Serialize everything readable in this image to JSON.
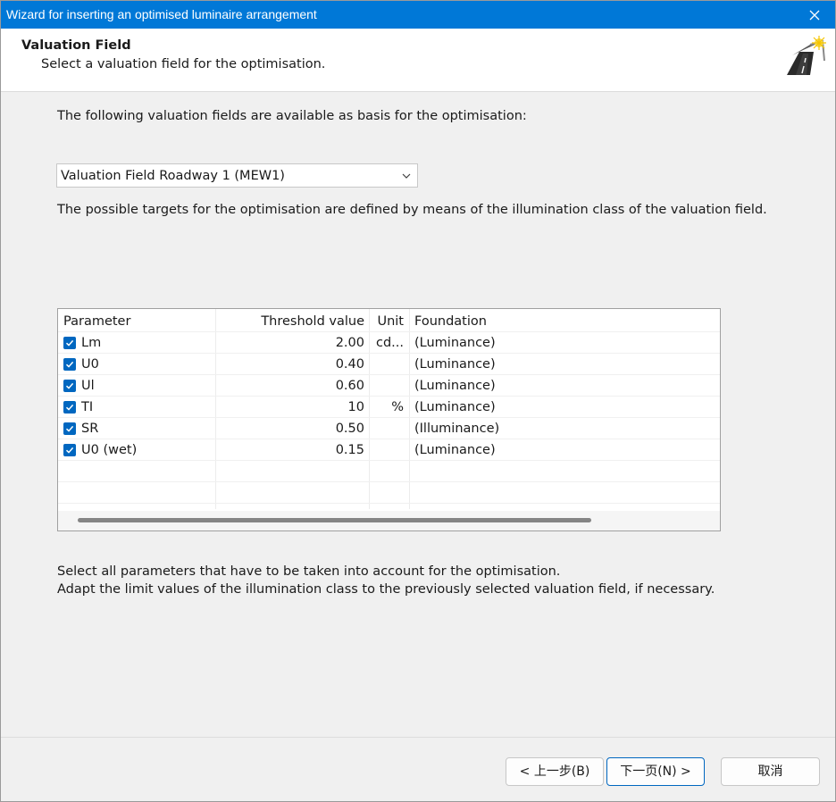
{
  "window": {
    "title": "Wizard for inserting an optimised luminaire arrangement"
  },
  "header": {
    "title": "Valuation Field",
    "subtitle": "Select a valuation field for the optimisation."
  },
  "intro_text": "The following valuation fields are available as basis for the optimisation:",
  "dropdown": {
    "selected": "Valuation Field Roadway 1 (MEW1)"
  },
  "targets_text": "The possible targets for the optimisation are defined by means of the illumination class of the valuation field.",
  "table": {
    "columns": [
      "Parameter",
      "Threshold value",
      "Unit",
      "Foundation"
    ],
    "rows": [
      {
        "parameter": "Lm",
        "threshold": "2.00",
        "unit": "cd...",
        "foundation": "(Luminance)",
        "checked": true
      },
      {
        "parameter": "U0",
        "threshold": "0.40",
        "unit": "",
        "foundation": "(Luminance)",
        "checked": true
      },
      {
        "parameter": "Ul",
        "threshold": "0.60",
        "unit": "",
        "foundation": "(Luminance)",
        "checked": true
      },
      {
        "parameter": "TI",
        "threshold": "10",
        "unit": "%",
        "foundation": "(Luminance)",
        "checked": true
      },
      {
        "parameter": "SR",
        "threshold": "0.50",
        "unit": "",
        "foundation": "(Illuminance)",
        "checked": true
      },
      {
        "parameter": "U0 (wet)",
        "threshold": "0.15",
        "unit": "",
        "foundation": "(Luminance)",
        "checked": true
      }
    ]
  },
  "bottom_text": {
    "line1": "Select all parameters that have to be taken into account for the optimisation.",
    "line2": "Adapt the limit values of the illumination class to the previously selected valuation field, if necessary."
  },
  "buttons": {
    "back": "< 上一步(B)",
    "next": "下一页(N) >",
    "cancel": "取消"
  },
  "colors": {
    "titlebar": "#0078d7",
    "checkbox": "#0067c0"
  },
  "icons": {
    "close": "close-icon",
    "logo": "road-luminaire-logo-icon",
    "chevron": "chevron-down-icon",
    "check": "check-icon"
  }
}
